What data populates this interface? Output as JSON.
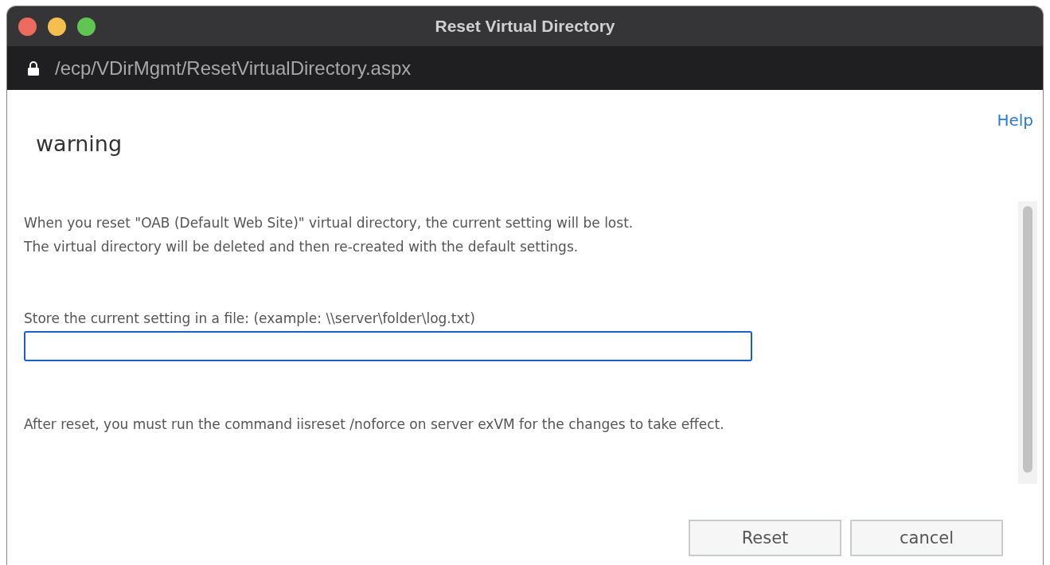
{
  "window": {
    "title": "Reset Virtual Directory",
    "address": "/ecp/VDirMgmt/ResetVirtualDirectory.aspx"
  },
  "help_link": "Help",
  "heading": "warning",
  "message": [
    "When you reset \"OAB (Default Web Site)\" virtual directory, the current setting will be lost.",
    "The virtual directory will be deleted and then re-created with the default settings."
  ],
  "file_field": {
    "label": "Store the current setting in a file: (example: \\\\server\\folder\\log.txt)",
    "focused": true
  },
  "note": "After reset, you must run the command iisreset /noforce on server exVM for the changes to take effect.",
  "buttons": [
    "Reset",
    "cancel"
  ]
}
